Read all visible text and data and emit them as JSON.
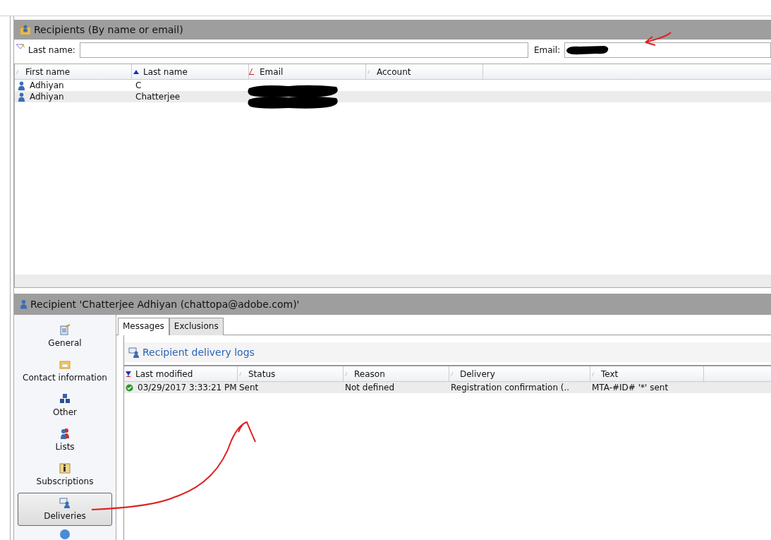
{
  "search_panel": {
    "title": "Recipients (By name or email)",
    "fields": [
      {
        "label": "Last name:",
        "redacted": false
      },
      {
        "label": "Email:",
        "redacted": true
      }
    ]
  },
  "recipients_table": {
    "columns": [
      {
        "label": "First name",
        "kind": "plain"
      },
      {
        "label": "Last name",
        "kind": "ascending"
      },
      {
        "label": "Email",
        "kind": "filter"
      },
      {
        "label": "Account",
        "kind": "plain"
      }
    ],
    "rows": [
      {
        "first_name": "Adhiyan",
        "last_name": "C",
        "email_redacted": true
      },
      {
        "first_name": "Adhiyan",
        "last_name": "Chatterjee",
        "email_redacted": true
      }
    ]
  },
  "detail_panel": {
    "title": "Recipient 'Chatterjee Adhiyan (chattopa@adobe.com)'",
    "nav": [
      {
        "label": "General",
        "kind": "form",
        "selected": false
      },
      {
        "label": "Contact information",
        "kind": "folder",
        "selected": false
      },
      {
        "label": "Other",
        "kind": "cubes",
        "selected": false
      },
      {
        "label": "Lists",
        "kind": "people",
        "selected": false
      },
      {
        "label": "Subscriptions",
        "kind": "info",
        "selected": false
      },
      {
        "label": "Deliveries",
        "kind": "delivery",
        "selected": true
      }
    ],
    "tabs": [
      {
        "label": "Messages",
        "selected": true
      },
      {
        "label": "Exclusions",
        "selected": false
      }
    ],
    "logs": {
      "title": "Recipient delivery logs",
      "columns": [
        {
          "label": "Last modified",
          "kind": "descending"
        },
        {
          "label": "Status",
          "kind": "plain"
        },
        {
          "label": "Reason",
          "kind": "plain"
        },
        {
          "label": "Delivery",
          "kind": "plain"
        },
        {
          "label": "Text",
          "kind": "plain"
        }
      ],
      "rows": [
        {
          "kind": "success",
          "cells": [
            "03/29/2017 3:33:21 PM",
            "Sent",
            "Not defined",
            "Registration confirmation (..",
            "MTA-#ID# '*' sent"
          ]
        }
      ]
    }
  }
}
